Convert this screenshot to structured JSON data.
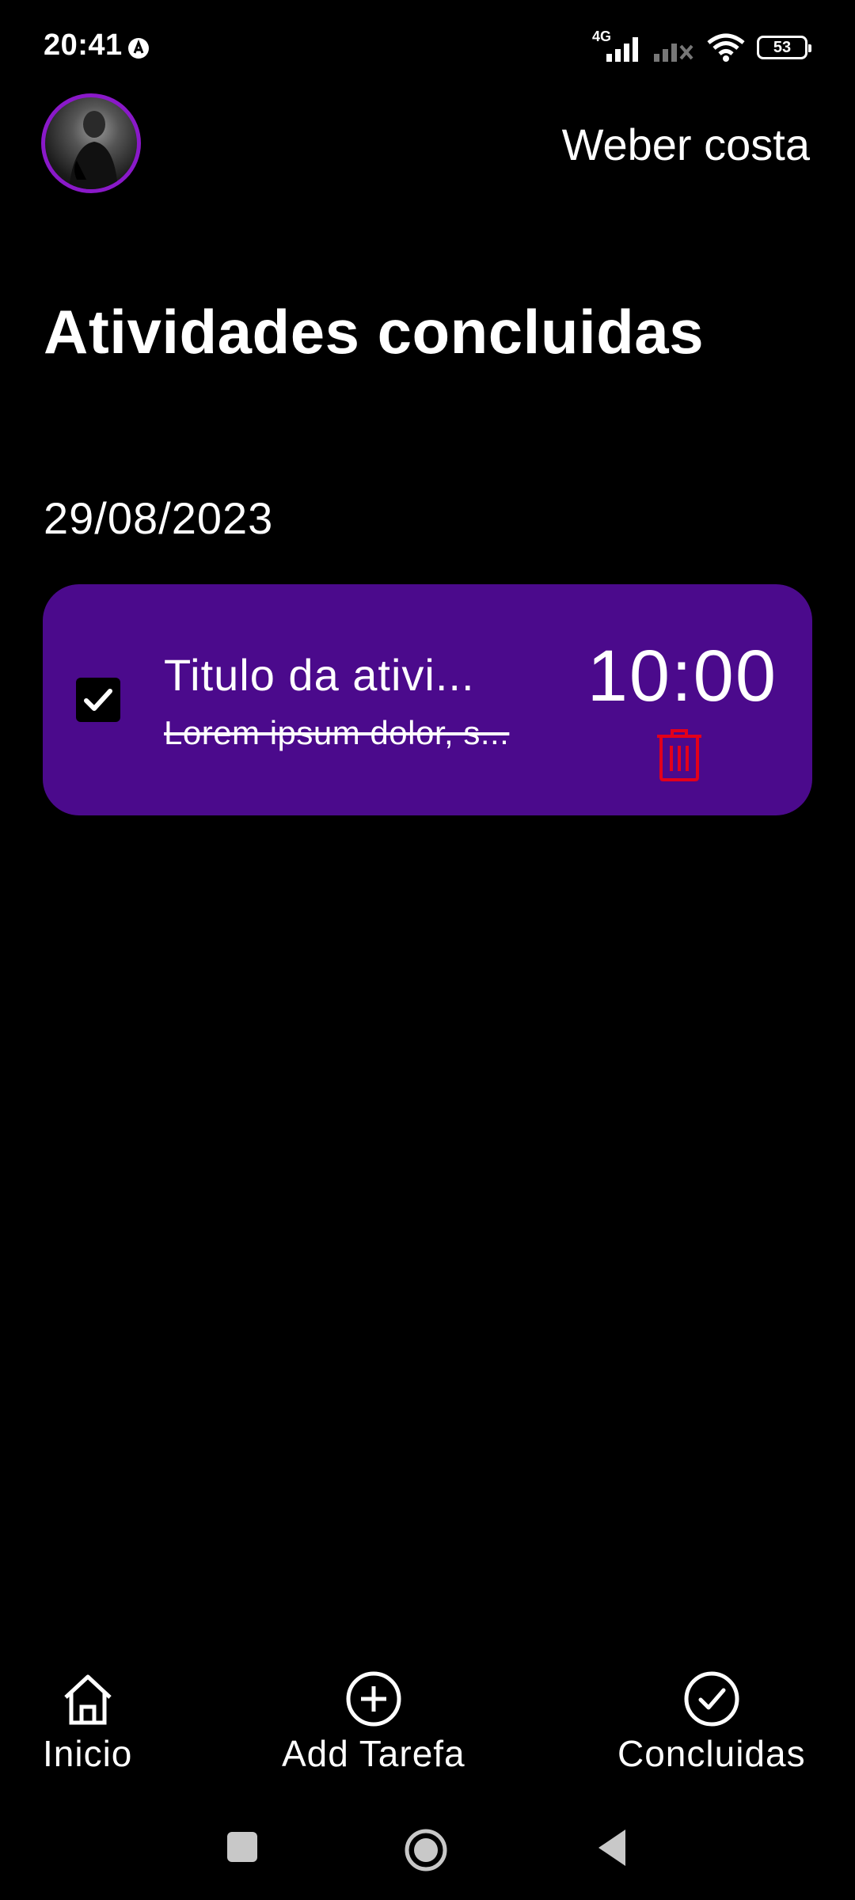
{
  "status_bar": {
    "time": "20:41",
    "network_type": "4G",
    "battery_level": "53"
  },
  "header": {
    "user_name": "Weber costa"
  },
  "page": {
    "title": "Atividades concluidas"
  },
  "groups": [
    {
      "date": "29/08/2023",
      "tasks": [
        {
          "title": "Titulo da ativi...",
          "description": "Lorem ipsum dolor, s...",
          "time": "10:00",
          "completed": true
        }
      ]
    }
  ],
  "bottom_nav": {
    "items": [
      {
        "label": "Inicio",
        "icon": "home-icon"
      },
      {
        "label": "Add Tarefa",
        "icon": "plus-circle-icon"
      },
      {
        "label": "Concluidas",
        "icon": "check-circle-icon"
      }
    ]
  },
  "colors": {
    "background": "#000000",
    "card": "#4b0a8c",
    "avatar_ring": "#8a19c9",
    "delete": "#e3001b",
    "text": "#ffffff"
  }
}
